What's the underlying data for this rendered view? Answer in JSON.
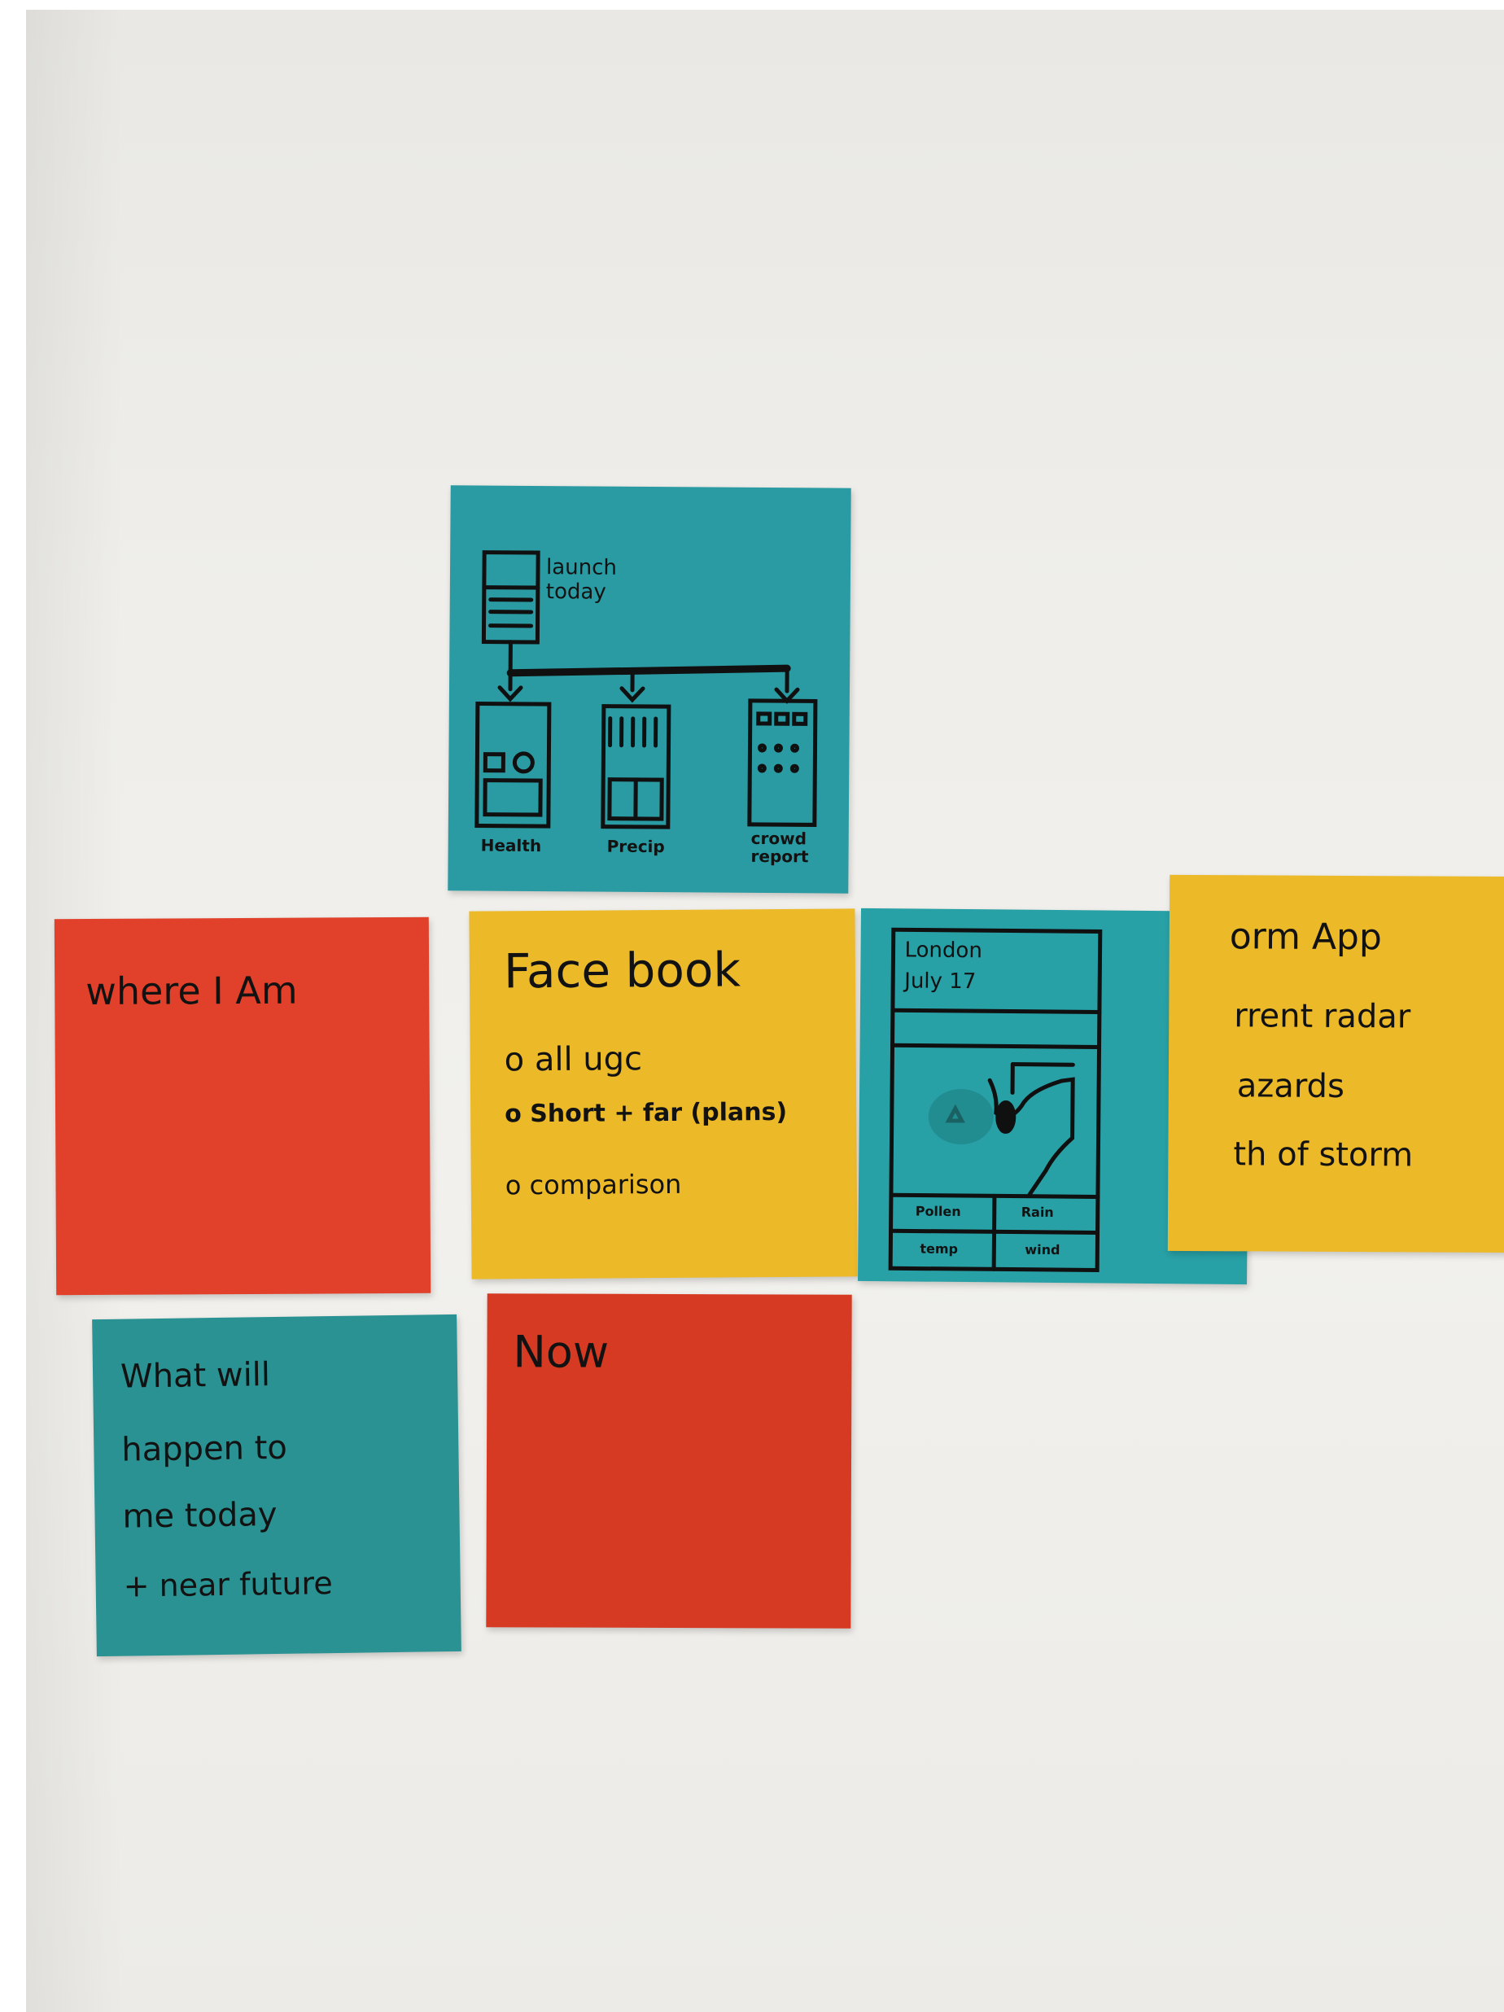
{
  "notes": {
    "where_i_am": {
      "text": "where I Am",
      "color": "#e1402a"
    },
    "now": {
      "text": "Now",
      "color": "#d73a22"
    },
    "what_will_happen": {
      "lines": [
        "What will",
        "happen to",
        "me today",
        "+ near future"
      ],
      "color": "#2a9292"
    },
    "facebook": {
      "title": "Face book",
      "items": [
        "o all ugc",
        "o Short + far (plans)",
        "o comparison"
      ],
      "color": "#ecb929"
    },
    "storm_app": {
      "title": "orm App",
      "items": [
        "rrent radar",
        "azards",
        "th of storm"
      ],
      "color": "#ecb929"
    },
    "launch_sketch": {
      "label_top": "launch today",
      "screens": [
        "Health",
        "Precip",
        "crowd report"
      ],
      "color": "#2a9ba3"
    },
    "map_sketch": {
      "place": "London",
      "date": "July 17",
      "buttons": [
        "Pollen",
        "Rain",
        "temp",
        "wind"
      ],
      "color": "#27a0a6"
    }
  }
}
